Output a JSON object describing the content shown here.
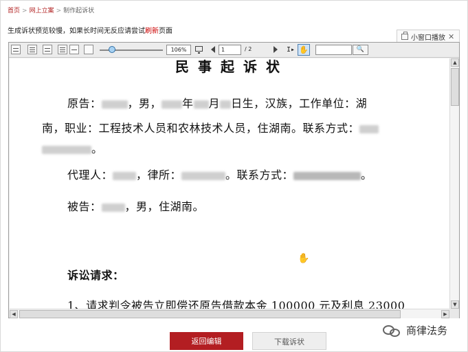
{
  "breadcrumb": {
    "items": [
      "首页",
      "网上立案",
      "制作起诉状"
    ],
    "separator": ">"
  },
  "notice": {
    "text_before": "生成诉状预览较慢，如果长时间无反应请尝试",
    "link": "刷新",
    "text_after": "页面"
  },
  "mini_player": {
    "label": "小窗口播放",
    "close": "✕"
  },
  "toolbar": {
    "zoom": "106%",
    "page_current": "1",
    "page_total": "/ 2",
    "search_value": "",
    "search_icon": "🔍"
  },
  "document": {
    "title": "民事起诉状",
    "lines": [
      [
        "原告：",
        "，男，",
        "年",
        "月",
        "日生，汉族，工作单位：湖"
      ],
      [
        "南，职业：工程技术人员和农林技术人员，住湖南。联系方式："
      ],
      [
        "。"
      ],
      [
        "代理人：",
        "，律所：",
        "。联系方式：",
        "。"
      ],
      [
        "被告：",
        "，男，住湖南。"
      ],
      [
        "诉讼请求："
      ],
      [
        "1、请求判令被告立即偿还原告借款本金 100000 元及利息 23000"
      ]
    ]
  },
  "buttons": {
    "back": "返回编辑",
    "download": "下载诉状"
  },
  "watermark": {
    "text": "商律法务"
  },
  "colors": {
    "accent": "#b31e22",
    "link": "#b22222"
  }
}
